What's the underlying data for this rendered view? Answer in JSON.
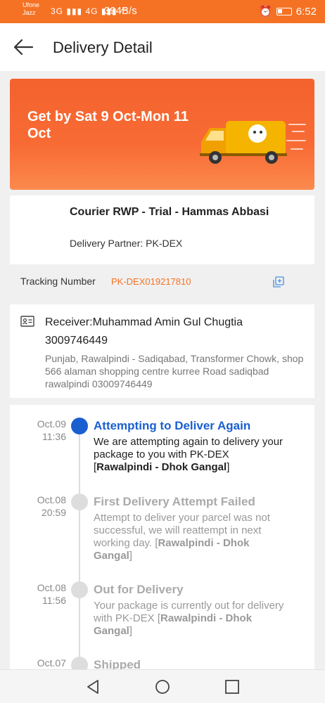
{
  "status_bar": {
    "carrier1": "Ufone",
    "carrier2": "Jazz",
    "network_icons": "3G ▮▮▮ 4G ▮▮▮ ◠",
    "speed": "394B/s",
    "time": "6:52"
  },
  "header": {
    "title": "Delivery Detail"
  },
  "banner": {
    "text": "Get by Sat 9 Oct-Mon 11 Oct"
  },
  "courier": {
    "name": "Courier RWP - Trial - Hammas Abbasi",
    "partner": "Delivery Partner: PK-DEX"
  },
  "tracking": {
    "label": "Tracking Number",
    "number": "PK-DEX019217810"
  },
  "receiver": {
    "name": "Receiver:Muhammad Amin Gul Chugtia",
    "phone": "3009746449",
    "address": "Punjab, Rawalpindi - Sadiqabad, Transformer Chowk, shop 566 alaman shopping centre kurree Road sadiqbad rawalpindi 03009746449"
  },
  "timeline": [
    {
      "date": "Oct.09",
      "time": "11:36",
      "title": "Attempting to Deliver Again",
      "desc": "We are attempting again to delivery your package to you with PK-DEX ",
      "location": "Rawalpindi - Dhok Gangal",
      "active": true
    },
    {
      "date": "Oct.08",
      "time": "20:59",
      "title": "First Delivery Attempt Failed",
      "desc": "Attempt to deliver your parcel was not successful, we will reattempt in next working day. ",
      "location": "Rawalpindi - Dhok Gangal",
      "active": false
    },
    {
      "date": "Oct.08",
      "time": "11:56",
      "title": "Out for Delivery",
      "desc": "Your package is currently out for delivery with PK-DEX ",
      "location": "Rawalpindi - Dhok Gangal",
      "active": false
    },
    {
      "date": "Oct.07",
      "time": "",
      "title": "Shipped",
      "desc": "",
      "location": "",
      "active": false
    }
  ],
  "colors": {
    "accent": "#f57224",
    "active": "#1a5fd0"
  }
}
